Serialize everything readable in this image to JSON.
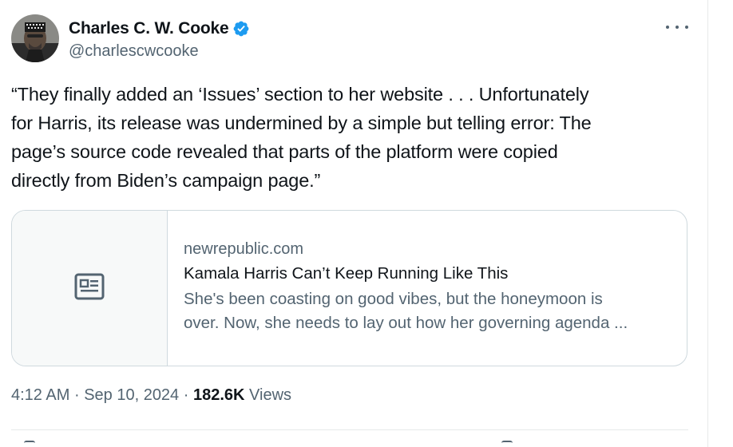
{
  "author": {
    "display_name": "Charles C. W. Cooke",
    "handle": "@charlescwcooke",
    "verified_color": "#1d9bf0"
  },
  "tweet": {
    "lines": [
      "“They finally added an ‘Issues’ section to her website . . . Unfortunately",
      "for Harris, its release was undermined by a simple but telling error: The",
      "page’s source code revealed that parts of the platform were copied",
      "directly from Biden’s campaign page.”"
    ]
  },
  "link_card": {
    "icon": "newspaper-icon",
    "domain": "newrepublic.com",
    "title": "Kamala Harris Can’t Keep Running Like This",
    "description_lines": [
      "She's been coasting on good vibes, but the honeymoon is",
      "over. Now, she needs to lay out how her governing agenda ..."
    ]
  },
  "meta": {
    "time": "4:12 AM",
    "separator": "·",
    "date": "Sep 10, 2024",
    "views_count": "182.6K",
    "views_label": "Views"
  },
  "icons": {
    "more": "more-icon",
    "verified": "verified-badge-icon"
  }
}
